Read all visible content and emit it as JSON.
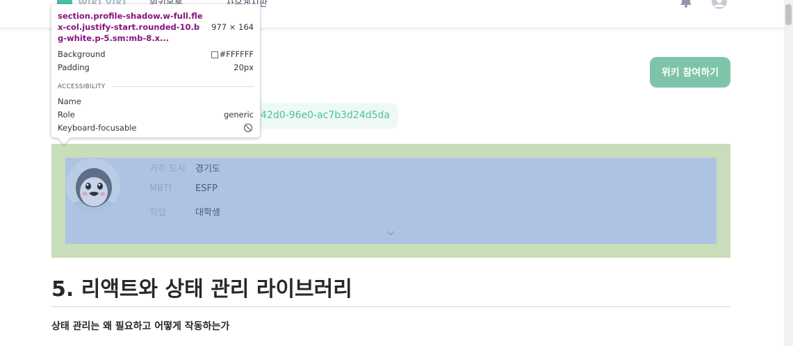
{
  "nav": {
    "logo": "wiki viki",
    "links": [
      "위키목록",
      "자유게시판"
    ]
  },
  "actions": {
    "join_label": "위키 참여하기"
  },
  "link_pill": {
    "text": "a-42d0-96e0-ac7b3d24d5da"
  },
  "profile": {
    "rows": [
      {
        "label": "거주 도시",
        "value": "경기도"
      },
      {
        "label": "MBTI",
        "value": "ESFP"
      },
      {
        "label": "직업",
        "value": "대학생"
      }
    ]
  },
  "article": {
    "title": "5. 리액트와 상태 관리 라이브러리",
    "subheading": "상태 관리는 왜 필요하고 어떻게 작동하는가"
  },
  "tooltip": {
    "selector": "section.profile-shadow.w-full.flex-col.justify-start.rounded-10.bg-white.p-5.sm:mb-8.x...",
    "size": "977 × 164",
    "background_label": "Background",
    "background_value": "#FFFFFF",
    "padding_label": "Padding",
    "padding_value": "20px",
    "section_heading": "ACCESSIBILITY",
    "name_label": "Name",
    "role_label": "Role",
    "role_value": "generic",
    "keyboard_label": "Keyboard-focusable"
  },
  "colors": {
    "accent": "#7EC4A8",
    "brand": "#4CBFA4",
    "highlight_padding": "#C8DDB9",
    "highlight_content": "#AEC3E3"
  }
}
